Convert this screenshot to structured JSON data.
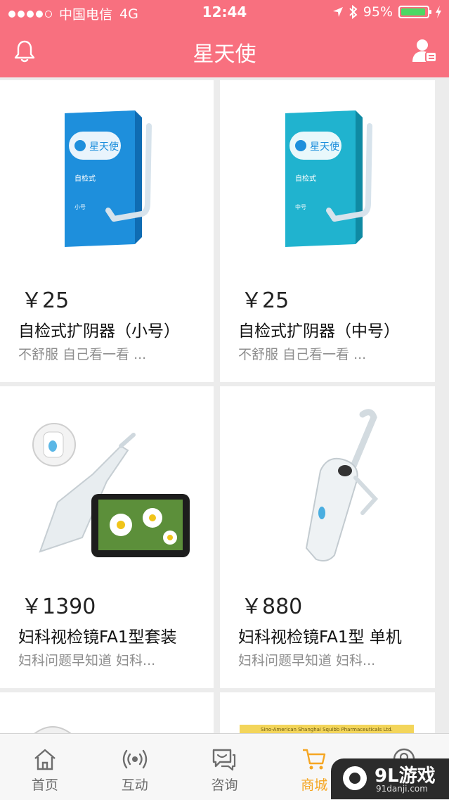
{
  "status_bar": {
    "carrier": "中国电信",
    "network": "4G",
    "time": "12:44",
    "battery": "95%",
    "battery_level": 0.95
  },
  "nav": {
    "title": "星天使",
    "accent_color": "#f8707f"
  },
  "products": [
    {
      "price": "￥25",
      "name": "自检式扩阴器（小号）",
      "desc": "不舒服 自己看一看 ...",
      "box_label": "星天使",
      "box_sub": "自检式",
      "box_size": "小号",
      "box_color": "#1e8fdc"
    },
    {
      "price": "￥25",
      "name": "自检式扩阴器（中号）",
      "desc": "不舒服 自己看一看 ...",
      "box_label": "星天使",
      "box_sub": "自检式",
      "box_size": "中号",
      "box_color": "#20b3cf"
    },
    {
      "price": "￥1390",
      "name": "妇科视检镜FA1型套装",
      "desc": "妇科问题早知道 妇科..."
    },
    {
      "price": "￥880",
      "name": "妇科视检镜FA1型 单机",
      "desc": "妇科问题早知道 妇科..."
    },
    {
      "partial_text": "Sino-American Shanghai Squibb Pharmaceuticals Ltd."
    }
  ],
  "tabs": [
    {
      "label": "首页",
      "icon": "home-icon"
    },
    {
      "label": "互动",
      "icon": "broadcast-icon"
    },
    {
      "label": "咨询",
      "icon": "chat-icon"
    },
    {
      "label": "商城",
      "icon": "cart-icon",
      "active": true
    },
    {
      "label": "",
      "icon": "profile-icon"
    }
  ],
  "watermark": {
    "logo": "9L游戏",
    "url": "91danji.com"
  },
  "colors": {
    "active_tab": "#f5a623",
    "price_text": "#222222",
    "desc_text": "#8e8e8e"
  }
}
